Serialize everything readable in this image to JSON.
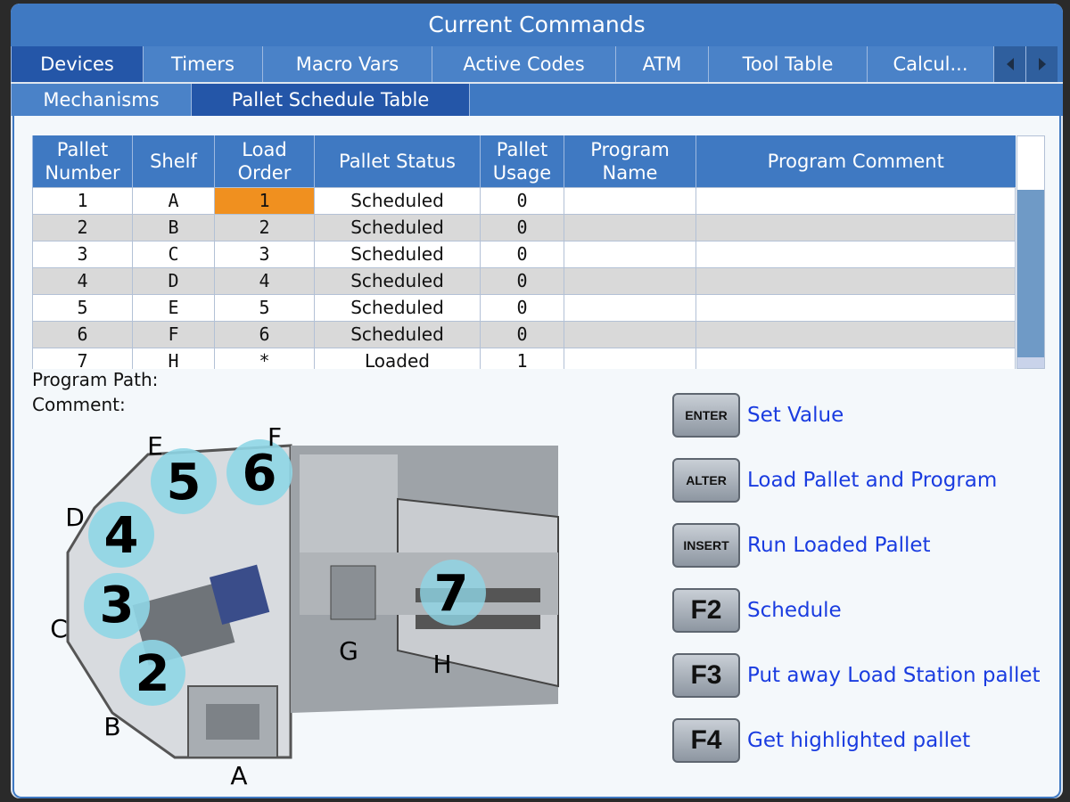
{
  "window_title": "Current Commands",
  "tabs_row1": [
    {
      "label": "Devices",
      "active": true
    },
    {
      "label": "Timers",
      "active": false
    },
    {
      "label": "Macro Vars",
      "active": false
    },
    {
      "label": "Active Codes",
      "active": false
    },
    {
      "label": "ATM",
      "active": false
    },
    {
      "label": "Tool Table",
      "active": false
    },
    {
      "label": "Calcul...",
      "active": false
    }
  ],
  "tabs_row2": [
    {
      "label": "Mechanisms",
      "active": false
    },
    {
      "label": "Pallet Schedule Table",
      "active": true
    }
  ],
  "table": {
    "headers": [
      "Pallet\nNumber",
      "Shelf",
      "Load\nOrder",
      "Pallet Status",
      "Pallet\nUsage",
      "Program\nName",
      "Program Comment"
    ],
    "rows": [
      [
        "1",
        "A",
        "1",
        "Scheduled",
        "0",
        "",
        ""
      ],
      [
        "2",
        "B",
        "2",
        "Scheduled",
        "0",
        "",
        ""
      ],
      [
        "3",
        "C",
        "3",
        "Scheduled",
        "0",
        "",
        ""
      ],
      [
        "4",
        "D",
        "4",
        "Scheduled",
        "0",
        "",
        ""
      ],
      [
        "5",
        "E",
        "5",
        "Scheduled",
        "0",
        "",
        ""
      ],
      [
        "6",
        "F",
        "6",
        "Scheduled",
        "0",
        "",
        ""
      ],
      [
        "7",
        "H",
        "*",
        "Loaded",
        "1",
        "",
        ""
      ]
    ],
    "highlighted_cell": {
      "row": 0,
      "col": 2
    }
  },
  "program_path_label": "Program Path:",
  "comment_label": "Comment:",
  "diagram": {
    "shelf_letters": [
      "A",
      "B",
      "C",
      "D",
      "E",
      "F",
      "G",
      "H"
    ],
    "pallet_numbers": [
      "2",
      "3",
      "4",
      "5",
      "6",
      "7"
    ]
  },
  "keys": [
    {
      "key": "ENTER",
      "label": "Set Value"
    },
    {
      "key": "ALTER",
      "label": "Load Pallet and Program"
    },
    {
      "key": "INSERT",
      "label": "Run Loaded Pallet"
    },
    {
      "key": "F2",
      "label": "Schedule"
    },
    {
      "key": "F3",
      "label": "Put away Load Station pallet"
    },
    {
      "key": "F4",
      "label": "Get highlighted pallet"
    }
  ],
  "colors": {
    "accent": "#3f79c2",
    "highlight": "#f0901f",
    "pallet": "#8fd6e6",
    "link": "#1a3ce0"
  }
}
